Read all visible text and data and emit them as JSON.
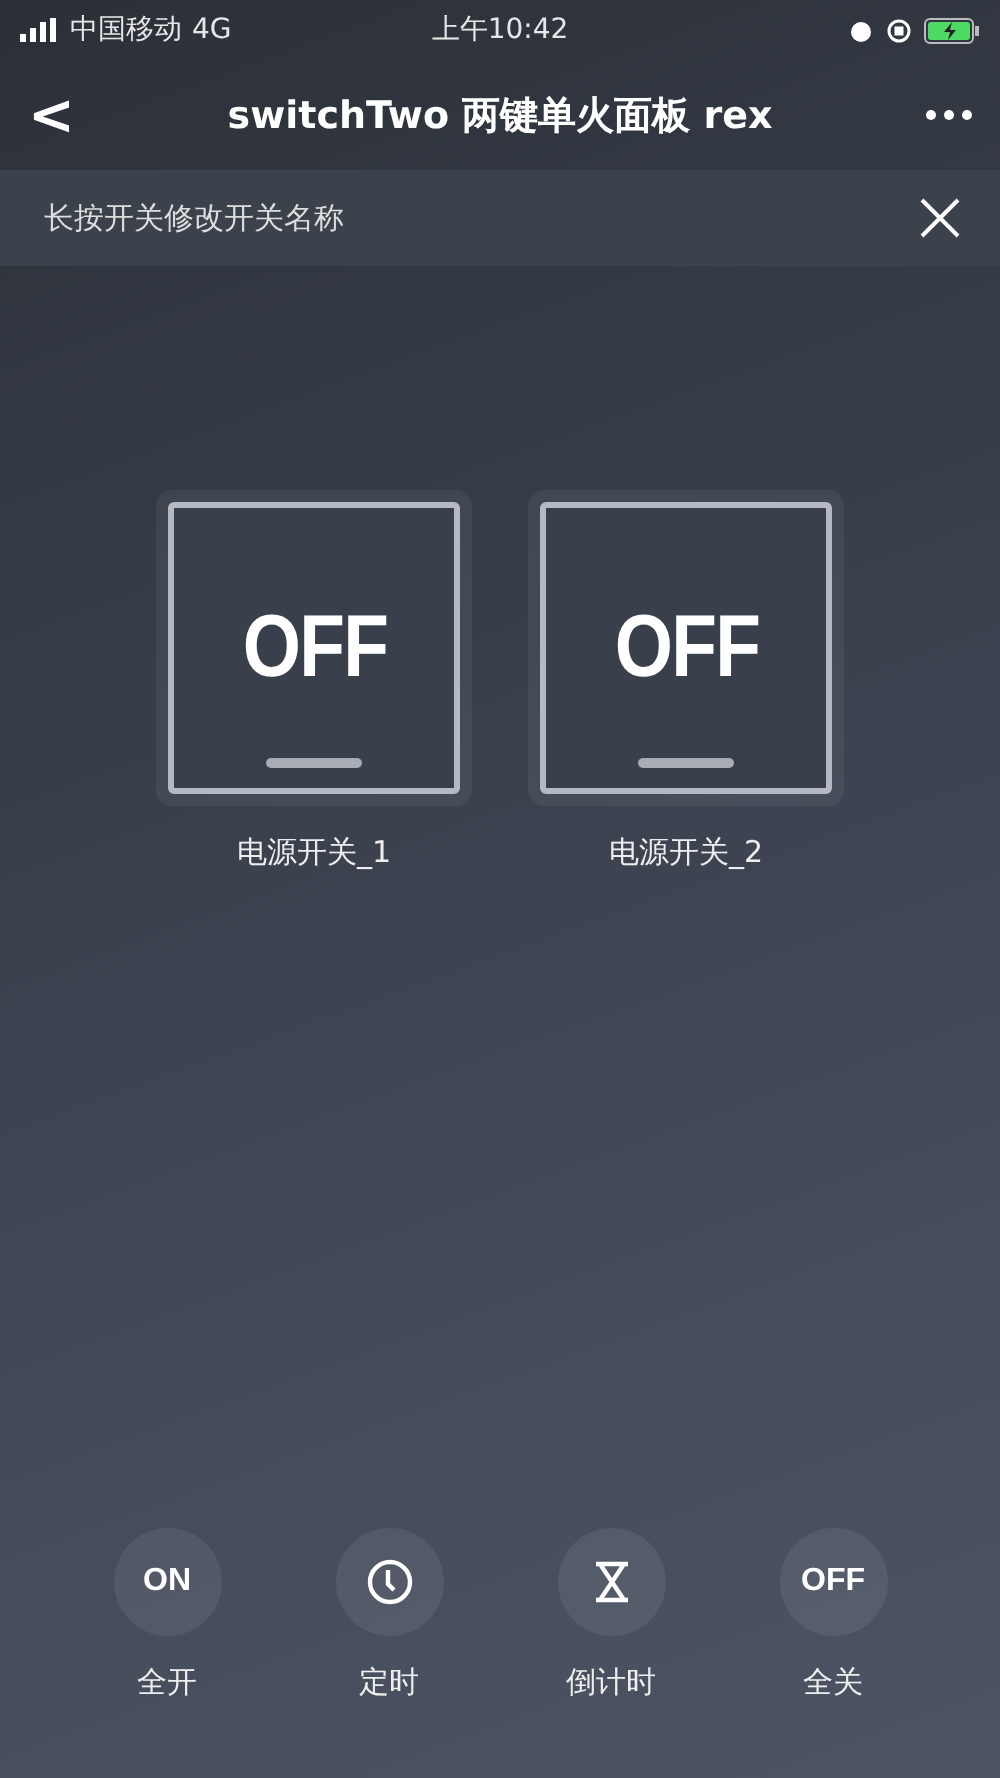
{
  "status_bar": {
    "carrier": "中国移动",
    "network": "4G",
    "time": "上午10:42"
  },
  "nav": {
    "back": "<",
    "title": "switchTwo 两键单火面板 rex"
  },
  "banner": {
    "text": "长按开关修改开关名称"
  },
  "switches": [
    {
      "state_text": "OFF",
      "on": false,
      "label": "电源开关_1"
    },
    {
      "state_text": "OFF",
      "on": false,
      "label": "电源开关_2"
    }
  ],
  "actions": [
    {
      "kind": "text",
      "icon_text": "ON",
      "label": "全开"
    },
    {
      "kind": "clock",
      "label": "定时"
    },
    {
      "kind": "hourglass",
      "label": "倒计时"
    },
    {
      "kind": "text",
      "icon_text": "OFF",
      "label": "全关"
    }
  ]
}
